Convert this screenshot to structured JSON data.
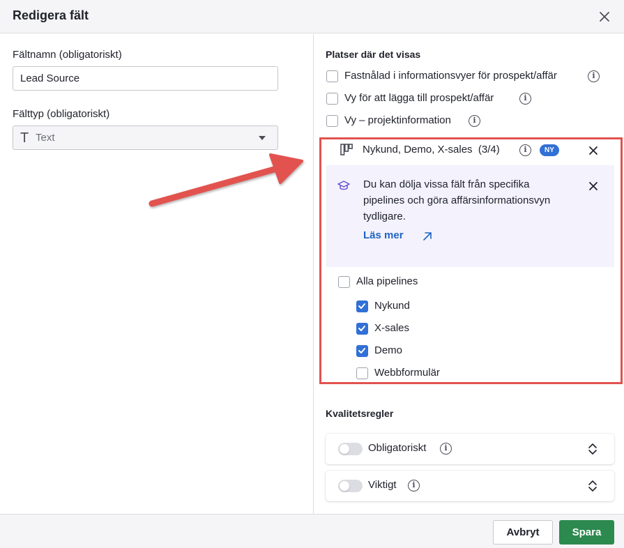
{
  "dialog": {
    "title": "Redigera fält"
  },
  "left": {
    "name_label": "Fältnamn (obligatoriskt)",
    "name_value": "Lead Source",
    "type_label": "Fälttyp (obligatoriskt)",
    "type_icon": "T",
    "type_value": "Text"
  },
  "right": {
    "places_title": "Platser där det visas",
    "places": [
      {
        "label": "Fastnålad i informationsvyer för prospekt/affär",
        "checked": false
      },
      {
        "label": "Vy för att lägga till prospekt/affär",
        "checked": false
      },
      {
        "label": "Vy – projektinformation",
        "checked": false
      }
    ],
    "pipeline_row": {
      "label": "Nykund, Demo, X-sales  (3/4)",
      "badge": "NY"
    },
    "notice": {
      "message": "Du kan dölja vissa fält från specifika pipelines och göra affärsinformationsvyn tydligare.",
      "link": "Läs mer"
    },
    "all_pipelines": {
      "label": "Alla pipelines",
      "checked": false
    },
    "pipelines": [
      {
        "label": "Nykund",
        "checked": true
      },
      {
        "label": "X-sales",
        "checked": true
      },
      {
        "label": "Demo",
        "checked": true
      },
      {
        "label": "Webbformulär",
        "checked": false
      }
    ],
    "quality_title": "Kvalitetsregler",
    "rules": [
      {
        "label": "Obligatoriskt",
        "on": false
      },
      {
        "label": "Viktigt",
        "on": false
      }
    ]
  },
  "footer": {
    "cancel": "Avbryt",
    "save": "Spara"
  },
  "colors": {
    "accent": "#3170d6",
    "save": "#2c8a4e",
    "highlight": "#e2524f",
    "notice_bg": "#f3f2fd"
  },
  "icons": {
    "info": "i"
  }
}
